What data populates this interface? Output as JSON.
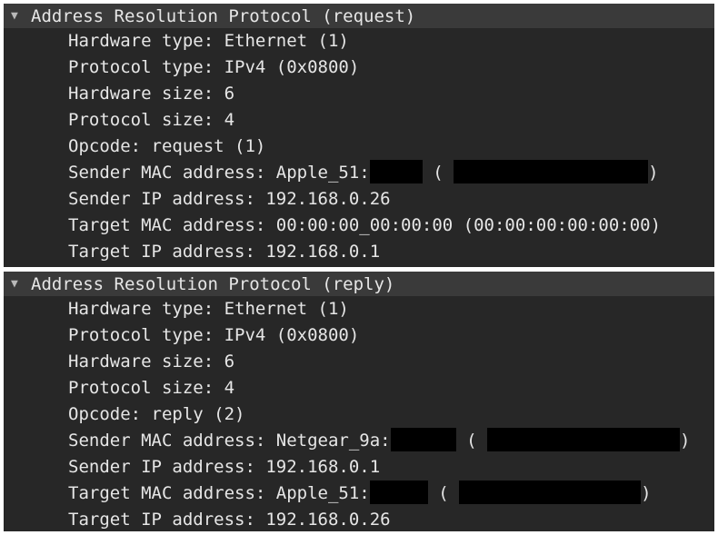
{
  "colors": {
    "background": "#272727",
    "header": "#3a3a3a",
    "text": "#e6e6e6",
    "redaction": "#000000"
  },
  "panels": [
    {
      "header": "Address Resolution Protocol (request)",
      "rows": [
        "Hardware type: Ethernet (1)",
        "Protocol type: IPv4 (0x0800)",
        "Hardware size: 6",
        "Protocol size: 4",
        "Opcode: request (1)",
        "Sender MAC address: Apple_51:",
        "Sender IP address: 192.168.0.26",
        "Target MAC address: 00:00:00_00:00:00 (00:00:00:00:00:00)",
        "Target IP address: 192.168.0.1"
      ]
    },
    {
      "header": "Address Resolution Protocol (reply)",
      "rows": [
        "Hardware type: Ethernet (1)",
        "Protocol type: IPv4 (0x0800)",
        "Hardware size: 6",
        "Protocol size: 4",
        "Opcode: reply (2)",
        "Sender MAC address: Netgear_9a:",
        "Sender IP address: 192.168.0.1",
        "Target MAC address: Apple_51:",
        "Target IP address: 192.168.0.26"
      ]
    }
  ],
  "glyphs": {
    "expand": "▼",
    "open_paren": "(",
    "close_paren": ")"
  }
}
